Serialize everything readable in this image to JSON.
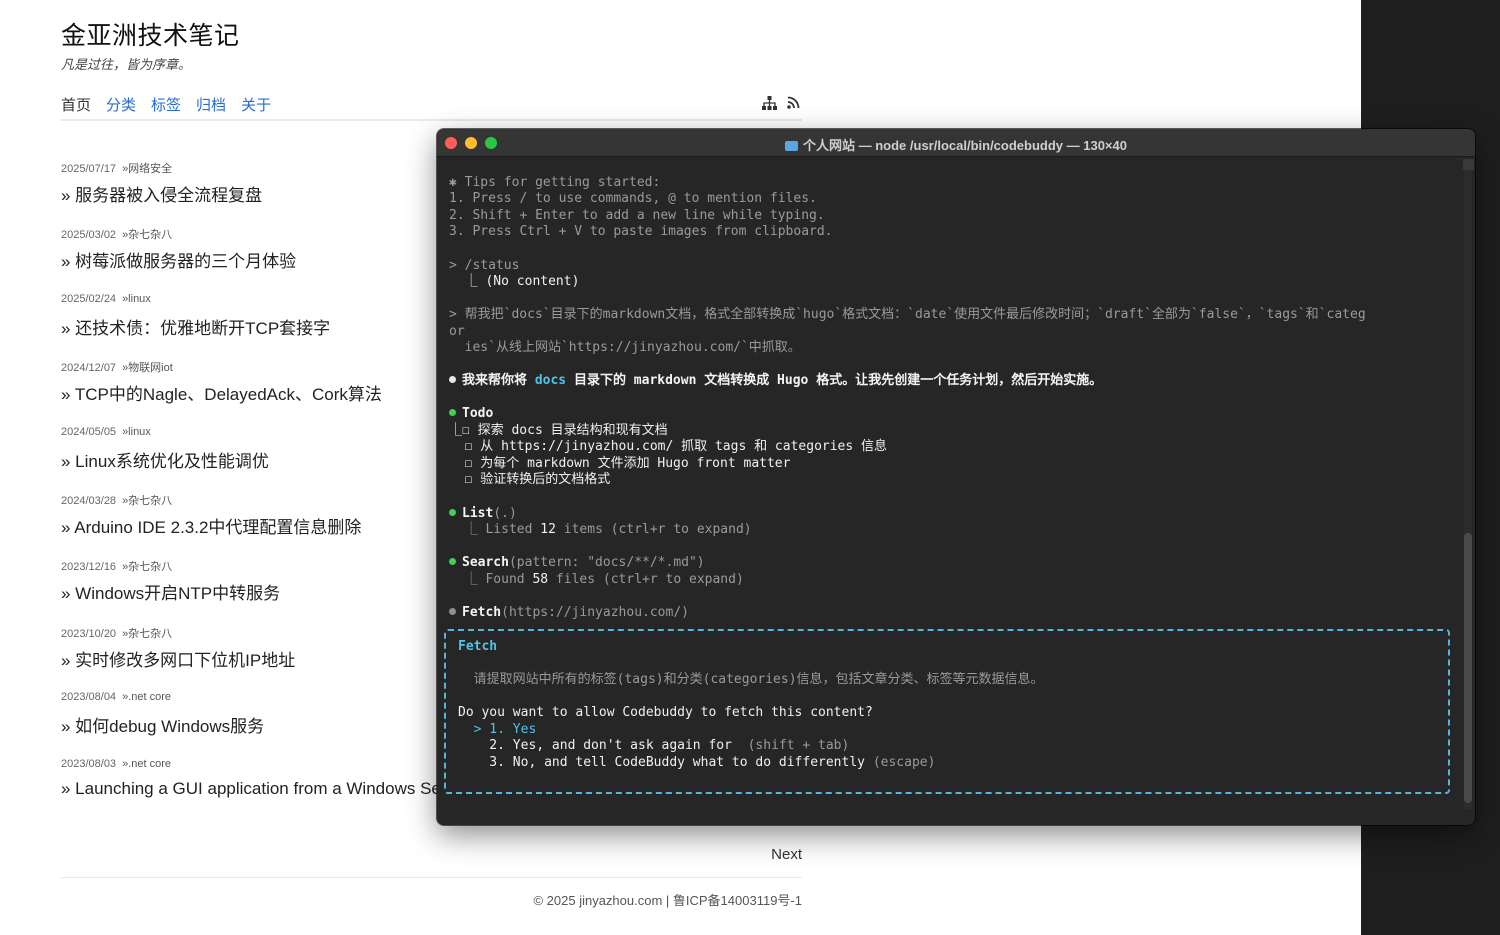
{
  "blog": {
    "title": "金亚洲技术笔记",
    "subtitle": "凡是过往，皆为序章。",
    "nav": [
      "首页",
      "分类",
      "标签",
      "归档",
      "关于"
    ],
    "icons": [
      "sitemap-icon",
      "rss-icon"
    ],
    "posts": [
      {
        "date": "2025/07/17",
        "category": "»网络安全",
        "title": "» 服务器被入侵全流程复盘"
      },
      {
        "date": "2025/03/02",
        "category": "»杂七杂八",
        "title": "» 树莓派做服务器的三个月体验"
      },
      {
        "date": "2025/02/24",
        "category": "»linux",
        "title": "» 还技术债：优雅地断开TCP套接字"
      },
      {
        "date": "2024/12/07",
        "category": "»物联网iot",
        "title": "» TCP中的Nagle、DelayedAck、Cork算法"
      },
      {
        "date": "2024/05/05",
        "category": "»linux",
        "title": "» Linux系统优化及性能调优"
      },
      {
        "date": "2024/03/28",
        "category": "»杂七杂八",
        "title": "» Arduino IDE 2.3.2中代理配置信息删除"
      },
      {
        "date": "2023/12/16",
        "category": "»杂七杂八",
        "title": "» Windows开启NTP中转服务"
      },
      {
        "date": "2023/10/20",
        "category": "»杂七杂八",
        "title": "» 实时修改多网口下位机IP地址"
      },
      {
        "date": "2023/08/04",
        "category": "».net core",
        "title": "» 如何debug Windows服务"
      },
      {
        "date": "2023/08/03",
        "category": "».net core",
        "title": "» Launching a GUI application from a Windows Service using C#"
      }
    ],
    "next_label": "Next",
    "footer": "© 2025 jinyazhou.com | 鲁ICP备14003119号-1"
  },
  "terminal": {
    "title": "个人网站 — node /usr/local/bin/codebuddy — 130×40",
    "tips_header": "✱ Tips for getting started:",
    "tips": [
      "1. Press / to use commands, @ to mention files.",
      "2. Shift + Enter to add a new line while typing.",
      "3. Press Ctrl + V to paste images from clipboard."
    ],
    "status_cmd": "> /status",
    "status_result": "  ⎿ (No content)",
    "prompt_line1": "> 帮我把`docs`目录下的markdown文档，格式全部转换成`hugo`格式文档：`date`使用文件最后修改时间；`draft`全部为`false`，`tags`和`categ",
    "prompt_line2": "or",
    "prompt_line3": "  ies`从线上网站`https://jinyazhou.com/`中抓取。",
    "assistant_pre": "我来帮你将 ",
    "assistant_hl": "docs",
    "assistant_post": " 目录下的 markdown 文档转换成 Hugo 格式。让我先创建一个任务计划，然后开始实施。",
    "todo_label": "Todo",
    "todos": [
      "⎿☐ 探索 docs 目录结构和现有文档",
      "  ☐ 从 https://jinyazhou.com/ 抓取 tags 和 categories 信息",
      "  ☐ 为每个 markdown 文件添加 Hugo front matter",
      "  ☐ 验证转换后的文档格式"
    ],
    "list_label": "List",
    "list_arg": "(.)",
    "list_result_pre": "  ⎿ Listed ",
    "list_count": "12",
    "list_result_post": " items (ctrl+r to expand)",
    "search_label": "Search",
    "search_arg": "(pattern: \"docs/**/*.md\")",
    "search_result_pre": "  ⎿ Found ",
    "search_count": "58",
    "search_result_post": " files (ctrl+r to expand)",
    "fetch_label": "Fetch",
    "fetch_arg": "(https://jinyazhou.com/)",
    "dialog": {
      "title": "Fetch",
      "description": "  请提取网站中所有的标签(tags)和分类(categories)信息，包括文章分类、标签等元数据信息。",
      "question": "Do you want to allow Codebuddy to fetch this content?",
      "options": [
        {
          "text": "  > 1. Yes",
          "hint": ""
        },
        {
          "text": "    2. Yes, and don't ask again for ",
          "hint": " (shift + tab)"
        },
        {
          "text": "    3. No, and tell CodeBuddy what to do differently",
          "hint": " (escape)"
        }
      ]
    }
  },
  "colors": {
    "link": "#2a6bd2",
    "terminal_bg": "#262626",
    "accent_cyan": "#4fc3e8",
    "bullet_green": "#3fcf5a"
  }
}
